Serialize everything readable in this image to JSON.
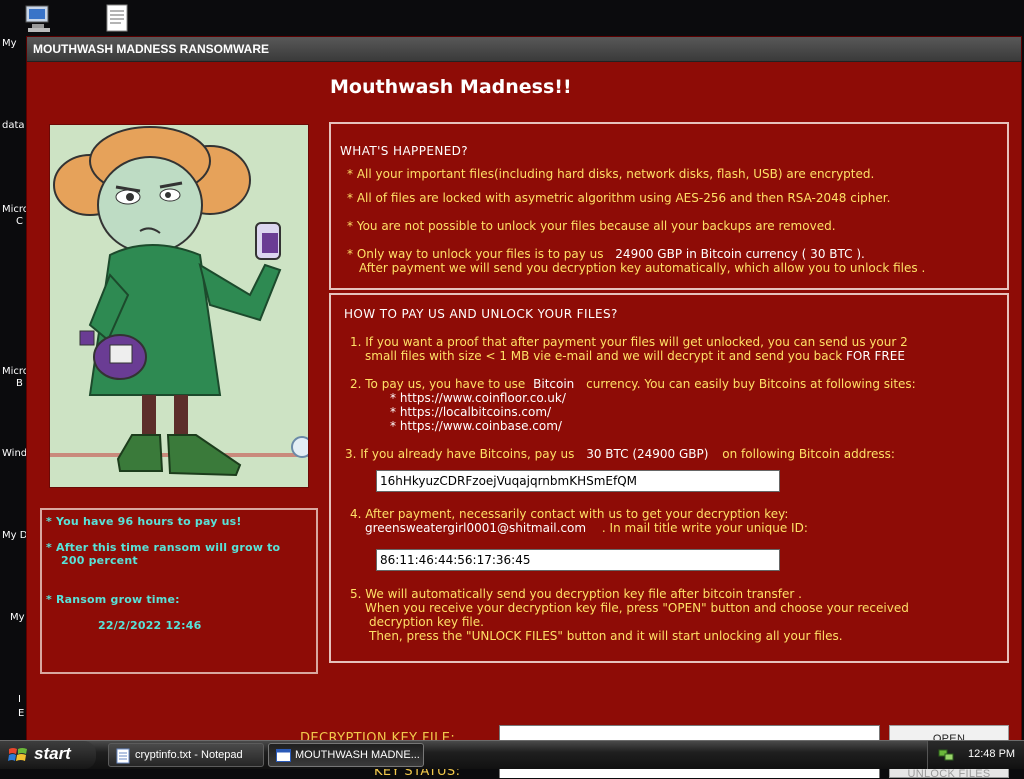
{
  "desktop": {
    "labels": [
      "My",
      "data",
      "Micro",
      "C",
      "Micro",
      "B",
      "Wind",
      "My D",
      "My",
      "I",
      "E"
    ]
  },
  "window": {
    "title": "MOUTHWASH MADNESS RANSOMWARE"
  },
  "main_title": "Mouthwash Madness!!",
  "timer": {
    "line1": "* You have 96 hours to pay us!",
    "line2": "* After this time ransom will grow to",
    "line3": "200 percent",
    "line4": "* Ransom grow time:",
    "datetime": "22/2/2022 12:46"
  },
  "what_happened": {
    "heading": "WHAT'S HAPPENED?",
    "b1": "All your important files(including hard disks, network disks, flash, USB) are encrypted.",
    "b2": "All of files are locked with asymetric algorithm using AES-256 and then RSA-2048 cipher.",
    "b3": "You are not possible to unlock your files because all your backups are removed.",
    "b4a": "Only way to unlock your files is to pay us",
    "b4_amount": "24900 GBP in Bitcoin currency ( 30 BTC ).",
    "b4b": "After payment we will send you decryption key automatically, which allow you to unlock files ."
  },
  "how_to_pay": {
    "heading": "HOW TO PAY US AND UNLOCK YOUR FILES?",
    "s1a": "1. If you want a proof that after payment your files will get unlocked, you can send us your 2",
    "s1b": "small files with size < 1 MB vie e-mail and we will decrypt it and send you back",
    "s1c": "FOR FREE",
    "s2a": "2. To pay us, you have to use",
    "s2_currency": "Bitcoin",
    "s2b": "currency. You can easily buy Bitcoins at following sites:",
    "sites": [
      "* https://www.coinfloor.co.uk/",
      "* https://localbitcoins.com/",
      "* https://www.coinbase.com/"
    ],
    "s3a": "3. If you already have Bitcoins, pay us",
    "s3_amount": "30 BTC (24900 GBP)",
    "s3b": "on following Bitcoin address:",
    "bitcoin_address": "16hHkyuzCDRFzoejVuqajqrnbmKHSmEfQM",
    "s4a": "4. After payment, necessarily contact with us to get your decryption key:",
    "s4_email": "greensweatergirl0001@shitmail.com",
    "s4b": ". In mail title write your unique ID:",
    "unique_id": "86:11:46:44:56:17:36:45",
    "s5a": "5. We will automatically send you decryption key file after bitcoin transfer .",
    "s5b": "When you receive your decryption key file, press \"OPEN\"  button and choose your received",
    "s5c": "decryption key file.",
    "s5d": "Then,  press the \"UNLOCK FILES\" button and it will start unlocking all your files."
  },
  "decryption": {
    "key_file_label": "DECRYPTION KEY FILE:",
    "key_file_value": "",
    "open_button": "OPEN",
    "key_status_label": "KEY STATUS:",
    "unlock_button": "UNLOCK FILES"
  },
  "taskbar": {
    "start_label": "start",
    "items": [
      "cryptinfo.txt - Notepad",
      "MOUTHWASH MADNE..."
    ],
    "clock": "12:48 PM"
  }
}
